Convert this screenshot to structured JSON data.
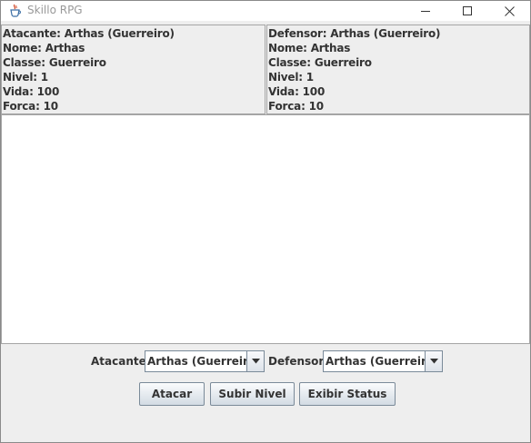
{
  "window": {
    "title": "Skillo RPG"
  },
  "icons": {
    "app": "java-cup-icon",
    "minimize": "minimize-icon",
    "maximize": "maximize-icon",
    "close": "close-icon",
    "dropdown": "chevron-down-icon"
  },
  "attacker_panel": {
    "header": "Atacante: Arthas (Guerreiro)",
    "name": "Nome: Arthas",
    "class": "Classe: Guerreiro",
    "level": "Nivel: 1",
    "life": "Vida: 100",
    "strength": "Forca: 10"
  },
  "defender_panel": {
    "header": "Defensor: Arthas (Guerreiro)",
    "name": "Nome: Arthas",
    "class": "Classe: Guerreiro",
    "level": "Nivel: 1",
    "life": "Vida: 100",
    "strength": "Forca: 10"
  },
  "log": {
    "text": ""
  },
  "controls": {
    "attacker_label": "Atacante:",
    "attacker_selected": "Arthas (Guerreiro)",
    "defender_label": "Defensor:",
    "defender_selected": "Arthas (Guerreiro)"
  },
  "actions": {
    "attack": "Atacar",
    "level_up": "Subir Nivel",
    "show_status": "Exibir Status"
  },
  "colors": {
    "panel_bg": "#eeeeee",
    "border": "#a5a5a5",
    "text": "#333333",
    "button_border": "#7a8a99"
  }
}
